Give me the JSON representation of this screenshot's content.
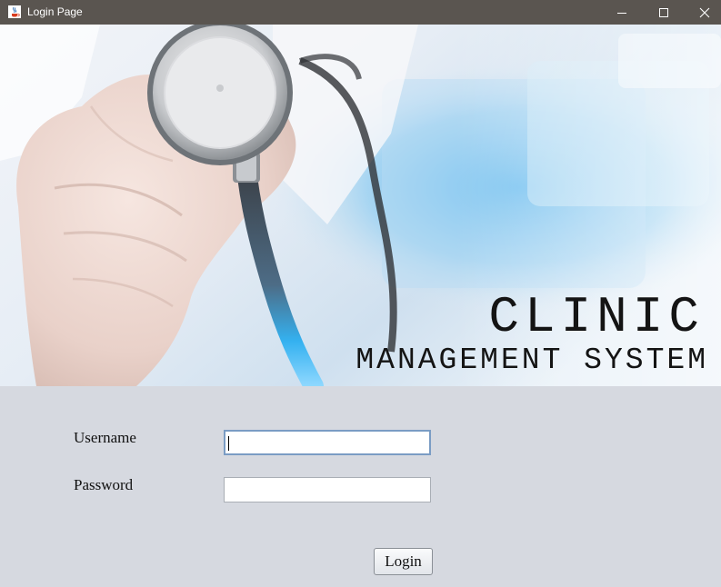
{
  "window": {
    "title": "Login Page",
    "icon": "java-cup-icon"
  },
  "banner": {
    "title": "CLINIC",
    "subtitle": "MANAGEMENT SYSTEM"
  },
  "form": {
    "username_label": "Username",
    "username_value": "",
    "password_label": "Password",
    "password_value": "",
    "login_label": "Login"
  },
  "colors": {
    "titlebar": "#5a5550",
    "form_background": "#d6d9e0",
    "focus_border": "#7a9cc4"
  }
}
